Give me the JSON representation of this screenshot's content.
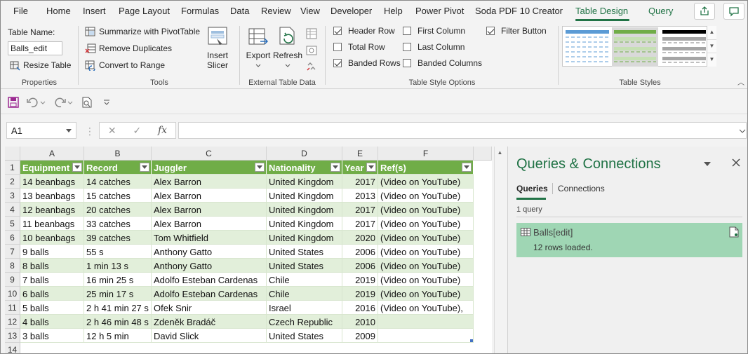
{
  "menu": {
    "tabs": [
      "File",
      "Home",
      "Insert",
      "Page Layout",
      "Formulas",
      "Data",
      "Review",
      "View",
      "Developer",
      "Help",
      "Power Pivot",
      "Soda PDF 10 Creator",
      "Table Design",
      "Query"
    ],
    "active": "Table Design"
  },
  "ribbon": {
    "properties": {
      "table_name_label": "Table Name:",
      "table_name_value": "Balls_edit",
      "resize_label": "Resize Table",
      "group_label": "Properties"
    },
    "tools": {
      "summarize_label": "Summarize with PivotTable",
      "remove_dup_label": "Remove Duplicates",
      "convert_label": "Convert to Range",
      "slicer_line1": "Insert",
      "slicer_line2": "Slicer",
      "group_label": "Tools"
    },
    "external": {
      "export_label": "Export",
      "refresh_label": "Refresh",
      "group_label": "External Table Data"
    },
    "style_options": {
      "header_row": "Header Row",
      "total_row": "Total Row",
      "banded_rows": "Banded Rows",
      "first_column": "First Column",
      "last_column": "Last Column",
      "banded_columns": "Banded Columns",
      "filter_button": "Filter Button",
      "group_label": "Table Style Options"
    },
    "styles": {
      "group_label": "Table Styles"
    }
  },
  "formula_bar": {
    "cell_ref": "A1",
    "fx": "fx",
    "content": ""
  },
  "sheet": {
    "columns": [
      "A",
      "B",
      "C",
      "D",
      "E",
      "F"
    ],
    "rows": [
      "1",
      "2",
      "3",
      "4",
      "5",
      "6",
      "7",
      "8",
      "9",
      "10",
      "11",
      "12",
      "13",
      "14"
    ],
    "headers": [
      "Equipment",
      "Record",
      "Juggler",
      "Nationality",
      "Year",
      "Ref(s)"
    ],
    "data": [
      [
        "14 beanbags",
        "14 catches",
        "Alex Barron",
        "United Kingdom",
        "2017",
        "(Video on YouTube)"
      ],
      [
        "13 beanbags",
        "15 catches",
        "Alex Barron",
        "United Kingdom",
        "2013",
        "(Video on YouTube)"
      ],
      [
        "12 beanbags",
        "20 catches",
        "Alex Barron",
        "United Kingdom",
        "2017",
        "(Video on YouTube)"
      ],
      [
        "11 beanbags",
        "33 catches",
        "Alex Barron",
        "United Kingdom",
        "2017",
        "(Video on YouTube)"
      ],
      [
        "10 beanbags",
        "39 catches",
        "Tom Whitfield",
        "United Kingdom",
        "2020",
        "(Video on YouTube)"
      ],
      [
        "9 balls",
        "55 s",
        "Anthony Gatto",
        "United States",
        "2006",
        "(Video on YouTube)"
      ],
      [
        "8 balls",
        "1 min 13 s",
        "Anthony Gatto",
        "United States",
        "2006",
        "(Video on YouTube)"
      ],
      [
        "7 balls",
        "16 min 25 s",
        "Adolfo Esteban Cardenas",
        "Chile",
        "2019",
        "(Video on YouTube)"
      ],
      [
        "6 balls",
        "25 min 17 s",
        "Adolfo Esteban Cardenas",
        "Chile",
        "2019",
        "(Video on YouTube)"
      ],
      [
        "5 balls",
        "2 h 41 min 27 s",
        "Ofek Snir",
        "Israel",
        "2016",
        "(Video on YouTube),"
      ],
      [
        "4 balls",
        "2 h 46 min 48 s",
        "Zdeněk Bradáč",
        "Czech Republic",
        "2010",
        ""
      ],
      [
        "3 balls",
        "12 h 5 min",
        "David Slick",
        "United States",
        "2009",
        ""
      ]
    ]
  },
  "queries_pane": {
    "title": "Queries & Connections",
    "tab_queries": "Queries",
    "tab_connections": "Connections",
    "count": "1 query",
    "query_name": "Balls[edit]",
    "query_status": "12 rows loaded."
  },
  "colors": {
    "accent": "#217346",
    "table_header": "#70ad47",
    "band": "#e2efda",
    "query_card": "#9fd6b4"
  }
}
